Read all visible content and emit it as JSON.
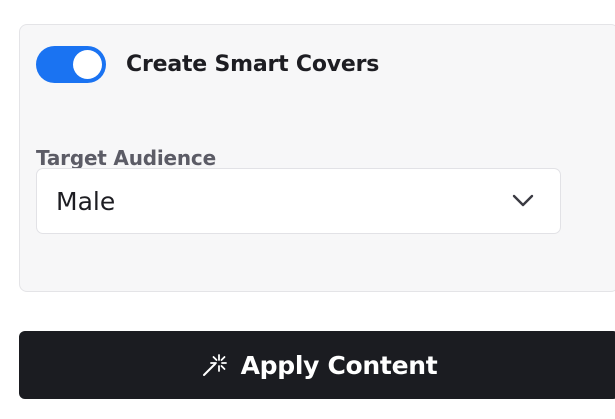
{
  "smart_covers": {
    "label": "Create Smart Covers",
    "enabled": true,
    "accent_color": "#1a73f2"
  },
  "target_audience": {
    "label": "Target Audience",
    "selected": "Male"
  },
  "apply_button": {
    "label": "Apply Content",
    "icon": "magic-wand-icon"
  }
}
